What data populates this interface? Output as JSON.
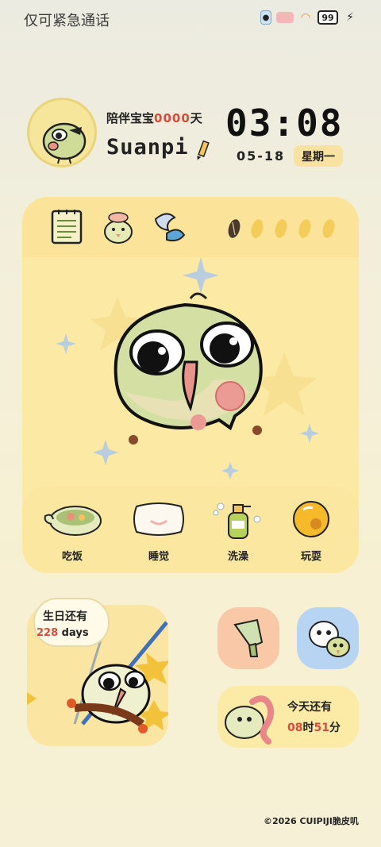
{
  "status_bar": {
    "title": "仅可紧急通话",
    "battery": "99"
  },
  "profile": {
    "companion_prefix": "陪伴宝宝",
    "companion_days": "0000",
    "companion_suffix": "天",
    "username": "Suanpi"
  },
  "clock": {
    "time": "03:08",
    "date": "05-18",
    "weekday": "星期一"
  },
  "main_card": {
    "tools": [
      "notebook-icon",
      "chick-icon",
      "ribbon-icon"
    ],
    "seeds_total": 5,
    "seeds_collected": 1
  },
  "care_actions": [
    {
      "label": "吃饭",
      "icon": "food-bowl-icon"
    },
    {
      "label": "睡觉",
      "icon": "pillow-icon"
    },
    {
      "label": "洗澡",
      "icon": "shampoo-bottle-icon"
    },
    {
      "label": "玩耍",
      "icon": "ball-icon"
    }
  ],
  "birthday": {
    "line1": "生日还有",
    "days_num": "228",
    "days_unit": "days"
  },
  "today": {
    "line1": "今天还有",
    "hours_num": "08",
    "hours_unit": "时",
    "minutes_num": "51",
    "minutes_unit": "分"
  },
  "footer": {
    "copyright": "©2026 CUIPIJI脆皮叽"
  },
  "colors": {
    "accent_red": "#d94a3b",
    "card_yellow": "#fbe9a4",
    "tile_peach": "#f9c9a7",
    "tile_blue": "#b8d4f3"
  }
}
